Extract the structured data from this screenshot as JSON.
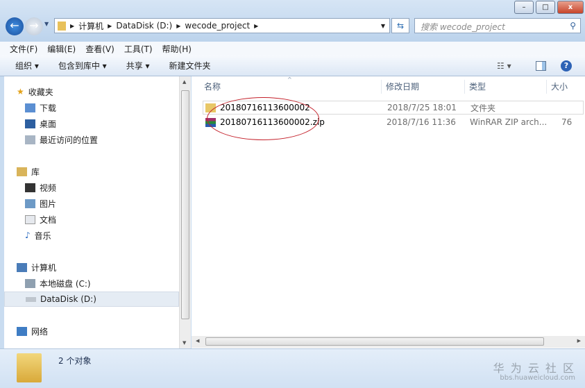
{
  "window": {
    "min": "–",
    "max": "□",
    "close": "x"
  },
  "address": {
    "segments": [
      "计算机",
      "DataDisk (D:)",
      "wecode_project"
    ]
  },
  "search": {
    "placeholder": "搜索 wecode_project"
  },
  "menu": [
    "文件(F)",
    "编辑(E)",
    "查看(V)",
    "工具(T)",
    "帮助(H)"
  ],
  "toolbar": [
    "组织 ▾",
    "包含到库中 ▾",
    "共享 ▾",
    "新建文件夹"
  ],
  "sidebar": {
    "favorites": "收藏夹",
    "fav_items": [
      "下载",
      "桌面",
      "最近访问的位置"
    ],
    "libraries": "库",
    "lib_items": [
      "视频",
      "图片",
      "文档",
      "音乐"
    ],
    "computer": "计算机",
    "drives": [
      "本地磁盘 (C:)",
      "DataDisk (D:)"
    ],
    "network": "网络"
  },
  "columns": [
    "名称",
    "修改日期",
    "类型",
    "大小"
  ],
  "files": [
    {
      "name": "20180716113600002",
      "date": "2018/7/25 18:01",
      "type": "文件夹",
      "size": ""
    },
    {
      "name": "20180716113600002.zip",
      "date": "2018/7/16 11:36",
      "type": "WinRAR ZIP arch...",
      "size": "76"
    }
  ],
  "status": {
    "count": "2 个对象"
  },
  "watermark": {
    "title": "华 为 云 社 区",
    "url": "bbs.huaweicloud.com"
  }
}
